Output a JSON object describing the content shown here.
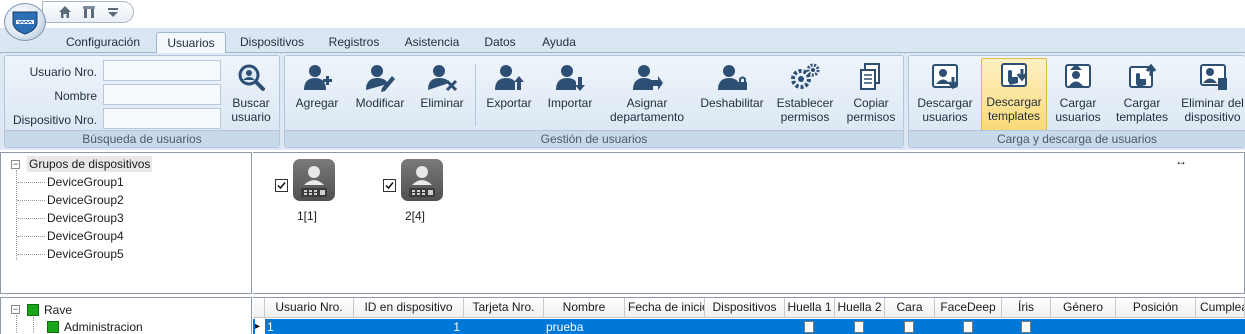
{
  "quickaccess": {
    "icons": [
      "home-icon",
      "tools-icon",
      "dropdown-icon"
    ]
  },
  "tabs": [
    {
      "label": "Configuración",
      "active": false
    },
    {
      "label": "Usuarios",
      "active": true
    },
    {
      "label": "Dispositivos",
      "active": false
    },
    {
      "label": "Registros",
      "active": false
    },
    {
      "label": "Asistencia",
      "active": false
    },
    {
      "label": "Datos",
      "active": false
    },
    {
      "label": "Ayuda",
      "active": false
    }
  ],
  "search": {
    "user_no_label": "Usuario Nro.",
    "name_label": "Nombre",
    "device_no_label": "Dispositivo Nro.",
    "user_no_value": "",
    "name_value": "",
    "device_no_value": "",
    "search_button_label": [
      "Buscar",
      "usuario"
    ],
    "caption": "Búsqueda de usuarios"
  },
  "user_management": {
    "buttons": [
      {
        "label": [
          "Agregar"
        ],
        "icon": "user-add-icon"
      },
      {
        "label": [
          "Modificar"
        ],
        "icon": "user-edit-icon"
      },
      {
        "label": [
          "Eliminar"
        ],
        "icon": "user-delete-icon"
      },
      {
        "label": [
          "Exportar"
        ],
        "icon": "user-export-icon"
      },
      {
        "label": [
          "Importar"
        ],
        "icon": "user-import-icon"
      },
      {
        "label": [
          "Asignar",
          "departamento"
        ],
        "icon": "user-assign-icon"
      },
      {
        "label": [
          "Deshabilitar"
        ],
        "icon": "user-disable-icon"
      },
      {
        "label": [
          "Establecer",
          "permisos"
        ],
        "icon": "gears-icon"
      },
      {
        "label": [
          "Copiar",
          "permisos"
        ],
        "icon": "copy-docs-icon"
      }
    ],
    "caption": "Gestión de usuarios"
  },
  "load_download": {
    "buttons": [
      {
        "label": [
          "Descargar",
          "usuarios"
        ],
        "icon": "download-users-icon",
        "highlight": false
      },
      {
        "label": [
          "Descargar",
          "templates"
        ],
        "icon": "download-templates-icon",
        "highlight": true
      },
      {
        "label": [
          "Cargar",
          "usuarios"
        ],
        "icon": "upload-users-icon",
        "highlight": false
      },
      {
        "label": [
          "Cargar",
          "templates"
        ],
        "icon": "upload-templates-icon",
        "highlight": false
      },
      {
        "label": [
          "Eliminar del",
          "dispositivo"
        ],
        "icon": "delete-from-device-icon",
        "highlight": false
      }
    ],
    "caption": "Carga y descarga de usuarios"
  },
  "device_tree": {
    "root": "Grupos de dispositivos",
    "children": [
      "DeviceGroup1",
      "DeviceGroup2",
      "DeviceGroup3",
      "DeviceGroup4",
      "DeviceGroup5"
    ]
  },
  "devices": [
    {
      "label": "1[1]",
      "checked": true
    },
    {
      "label": "2[4]",
      "checked": true
    }
  ],
  "org_tree": {
    "root": "Rave",
    "children": [
      "Administracion"
    ]
  },
  "grid": {
    "columns": [
      "Usuario Nro.",
      "ID en dispositivo",
      "Tarjeta Nro.",
      "Nombre",
      "Fecha de inicio",
      "Dispositivos",
      "Huella 1",
      "Huella 2",
      "Cara",
      "FaceDeep",
      "Íris",
      "Género",
      "Posición",
      "Cumpleaños"
    ],
    "rows": [
      {
        "user_no": "1",
        "device_id": "1",
        "card_no": "",
        "name": "prueba",
        "start_date": "",
        "devices": "",
        "finger1": "doc-icon",
        "finger2": "doc-icon",
        "face": "doc-icon",
        "facedeep": "doc-icon",
        "iris": "doc-icon",
        "gender": "",
        "position": "",
        "birthday": ""
      }
    ]
  },
  "colors": {
    "accent": "#0078d7",
    "ribbon": "#dde8f4",
    "highlight": "#fbd978",
    "org_node": "#1aa51a"
  }
}
